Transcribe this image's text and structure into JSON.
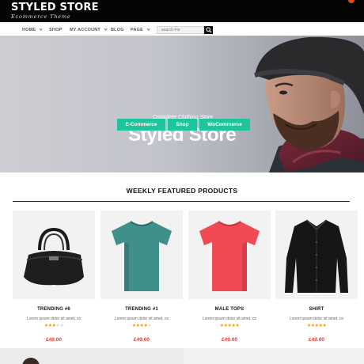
{
  "header": {
    "brand_title": "STYLED STORE",
    "brand_subtitle": "Ecommerce Theme"
  },
  "nav": {
    "items": [
      {
        "label": "HOME",
        "active": true,
        "has_dropdown": true
      },
      {
        "label": "SHOP",
        "active": false,
        "has_dropdown": false
      },
      {
        "label": "MY ACCOUNT",
        "active": false,
        "has_dropdown": true
      },
      {
        "label": "BLOG",
        "active": false,
        "has_dropdown": false
      },
      {
        "label": "PAGE",
        "active": false,
        "has_dropdown": true
      }
    ],
    "search_placeholder": "search For",
    "search_icon": "search-icon"
  },
  "hero": {
    "subtitle": "Complete Clothing Store",
    "title": "Styled Store",
    "buttons": [
      "E-Commerce",
      "Shop",
      "WoCommerce"
    ]
  },
  "featured": {
    "heading": "WEEKLY FEATURED PRODUCTS",
    "products": [
      {
        "name": "TRENDING #6",
        "description": "Lorem ipsum dolor sit amet, co",
        "rating": 3,
        "price": "£49.00",
        "image": "handbag"
      },
      {
        "name": "TRENDING #1",
        "description": "Lorem ipsum dolor sit amet, co",
        "rating": 4,
        "price": "£49.00",
        "image": "teal-tshirt"
      },
      {
        "name": "MALE TOPS",
        "description": "Lorem ipsum dolor sit amet, co",
        "rating": 5,
        "price": "£49.00",
        "image": "red-tshirt"
      },
      {
        "name": "SHIRT",
        "description": "Lorem ipsum dolor sit amet, co",
        "rating": 5,
        "price": "£49.00",
        "image": "black-shirt"
      }
    ],
    "rating_max": 5
  },
  "colors": {
    "accent": "#1ec49c",
    "price": "#e53935",
    "star": "#f29b11",
    "header_bg": "#050505"
  }
}
